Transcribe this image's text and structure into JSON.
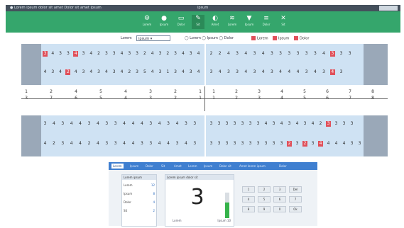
{
  "titlebar": {
    "left": "● Lorem ipsum dolor sit amet   Dolor sit amet ipsum",
    "center": "ipsum"
  },
  "toolbar": {
    "buttons": [
      {
        "glyph": "⚙",
        "label": "Lorem"
      },
      {
        "glyph": "●",
        "label": "Ipsum"
      },
      {
        "glyph": "▭",
        "label": "Dolor"
      },
      {
        "glyph": "✎",
        "label": "Sit"
      },
      {
        "glyph": "◐",
        "label": "Amet"
      },
      {
        "glyph": "≋",
        "label": "Lorem"
      },
      {
        "glyph": "▼",
        "label": "Ipsum"
      },
      {
        "glyph": "≡",
        "label": "Dolor"
      },
      {
        "glyph": "✕",
        "label": "Sit"
      }
    ]
  },
  "selector": {
    "label": "Lorem",
    "value": "ipsum",
    "option": "◯ Lorem   ◯ Ipsum   ◯ Dolor"
  },
  "legend": [
    "Lorem",
    "Ipsum",
    "Dolor"
  ],
  "top_left": {
    "row1": [
      "3",
      "4",
      "3",
      "3",
      "4",
      "3",
      "4",
      "2",
      "3",
      "3",
      "4",
      "3",
      "3",
      "2",
      "4",
      "3",
      "2",
      "3",
      "4",
      "3",
      "4"
    ],
    "row2": [
      "4",
      "3",
      "4",
      "2",
      "4",
      "3",
      "4",
      "3",
      "4",
      "3",
      "4",
      "2",
      "3",
      "5",
      "4",
      "3",
      "1",
      "3",
      "4",
      "3",
      "4"
    ]
  },
  "top_right": {
    "row1": [
      "2",
      "2",
      "4",
      "3",
      "4",
      "3",
      "4",
      "3",
      "3",
      "3",
      "3",
      "3",
      "3",
      "4",
      "3",
      "3",
      "3"
    ],
    "row2": [
      "3",
      "4",
      "3",
      "3",
      "4",
      "3",
      "4",
      "3",
      "4",
      "4",
      "4",
      "3",
      "4",
      "3",
      "4",
      "3"
    ]
  },
  "fractions_left": [
    {
      "n": "1",
      "d": "3"
    },
    {
      "n": "2",
      "d": "7"
    },
    {
      "n": "4",
      "d": "6"
    },
    {
      "n": "5",
      "d": "5"
    },
    {
      "n": "4",
      "d": "4"
    },
    {
      "n": "3",
      "d": "3"
    },
    {
      "n": "2",
      "d": "2"
    },
    {
      "n": "1",
      "d": "1"
    }
  ],
  "fractions_right": [
    {
      "n": "1",
      "d": "1"
    },
    {
      "n": "2",
      "d": "2"
    },
    {
      "n": "3",
      "d": "3"
    },
    {
      "n": "4",
      "d": "4"
    },
    {
      "n": "5",
      "d": "5"
    },
    {
      "n": "6",
      "d": "6"
    },
    {
      "n": "7",
      "d": "7"
    },
    {
      "n": "8",
      "d": "8"
    }
  ],
  "bottom_left": {
    "row1": [
      "3",
      "4",
      "3",
      "4",
      "4",
      "3",
      "4",
      "3",
      "3",
      "4",
      "4",
      "4",
      "3",
      "4",
      "3",
      "4",
      "3",
      "3"
    ],
    "row2": [
      "4",
      "2",
      "3",
      "4",
      "4",
      "2",
      "4",
      "3",
      "3",
      "4",
      "4",
      "3",
      "3",
      "4",
      "4",
      "3",
      "4",
      "3"
    ]
  },
  "bottom_right": {
    "row1": [
      "3",
      "3",
      "3",
      "3",
      "3",
      "3",
      "3",
      "4",
      "3",
      "4",
      "3",
      "4",
      "3",
      "4",
      "2",
      "3",
      "3",
      "3",
      "3"
    ],
    "row2": [
      "3",
      "3",
      "3",
      "3",
      "3",
      "3",
      "3",
      "3",
      "3",
      "3",
      "2",
      "3",
      "2",
      "3",
      "4",
      "4",
      "4",
      "4",
      "3",
      "3"
    ]
  },
  "tabs": [
    "Lorem",
    "Ipsum",
    "Dolor",
    "Sit",
    "Amet",
    "Lorem",
    "Ipsum",
    "Dolor sit",
    "Amet lorem ipsum",
    "Dolor"
  ],
  "stats": {
    "title": "Lorem ipsum",
    "rows": [
      {
        "label": "Lorem",
        "value": "12"
      },
      {
        "label": "Ipsum",
        "value": "8"
      },
      {
        "label": "Dolor",
        "value": "4"
      },
      {
        "label": "Sit",
        "value": "2"
      }
    ]
  },
  "counter": {
    "title": "Lorem ipsum dolor sit",
    "value": "3",
    "footer_left": "Lorem",
    "footer_right": "Ipsum 10"
  },
  "keypad": [
    "1",
    "2",
    "3",
    "Del",
    "4",
    "5",
    "6",
    "7",
    "8",
    "9",
    "0",
    "Ok"
  ]
}
